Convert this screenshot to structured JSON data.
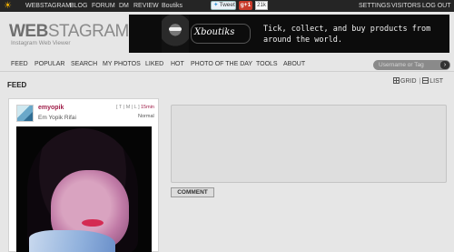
{
  "topbar": {
    "links_left": [
      "WEBSTAGRAM",
      "BLOG",
      "FORUM",
      "DM",
      "REVIEW",
      "Boutiks"
    ],
    "tweet_label": "Tweet",
    "gplus_label": "g+1",
    "share_count": "21k",
    "links_right": [
      "SETTINGS",
      "VISITORS",
      "LOG OUT"
    ]
  },
  "header": {
    "logo_bold": "WEB",
    "logo_light": "STAGRAM",
    "tagline": "Instagram Web Viewer"
  },
  "banner": {
    "brand": "Xboutiks",
    "slogan": "Tick, collect, and buy products from around the world."
  },
  "nav": {
    "items": [
      "FEED",
      "POPULAR",
      "SEARCH",
      "MY PHOTOS",
      "LIKED",
      "HOT",
      "PHOTO OF THE DAY",
      "TOOLS",
      "ABOUT"
    ],
    "search_placeholder": "Username or Tag"
  },
  "feed": {
    "title": "FEED",
    "view_grid": "GRID",
    "view_list": "LIST"
  },
  "post": {
    "username": "emyopik",
    "full_name": "Em Yopik Rifai",
    "services": "[ T | M | L ]",
    "time_ago": "15min",
    "filter": "Normal"
  },
  "comment": {
    "button_label": "COMMENT"
  },
  "colors": {
    "topbar_bg": "#252525",
    "accent_user": "#a0204a",
    "page_bg": "#e6e6e6"
  }
}
